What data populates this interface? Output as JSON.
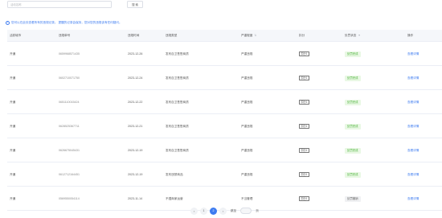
{
  "search": {
    "placeholder": "活动名称",
    "button_label": "搜 索"
  },
  "notice": {
    "icon": "info-circle-icon",
    "text": "您可以在此处查看所有的违规记录。 提醒的记录会保持，您对您的违规该有任何疑问。"
  },
  "table": {
    "headers": {
      "region": "活跃城市",
      "record_no": "违规单号",
      "time": "违规时间",
      "type": "违规类型",
      "level": "严重程度",
      "penalty": "扣分",
      "status": "处罚状态",
      "action": "操作"
    },
    "rows": [
      {
        "region": "开通",
        "record_no": "0659968571435",
        "time": "2023-12-26",
        "type": "发布自卫售售商质",
        "level": "严重违规",
        "penalty": "扣分1",
        "status": "处罚完成",
        "status_type": "ok",
        "action": "查看详情"
      },
      {
        "region": "开通",
        "record_no": "0602710071750",
        "time": "2023-12-24",
        "type": "发布自卫售售商质",
        "level": "严重违规",
        "penalty": "扣分1",
        "status": "处罚完成",
        "status_type": "ok",
        "action": "查看详情"
      },
      {
        "region": "开通",
        "record_no": "0651110015424",
        "time": "2023-12-22",
        "type": "发布自卫售售商质",
        "level": "严重违规",
        "penalty": "扣分1",
        "status": "处罚完成",
        "status_type": "ok",
        "action": "查看详情"
      },
      {
        "region": "开通",
        "record_no": "0628525367711",
        "time": "2023-12-21",
        "type": "发布自卫售售商质",
        "level": "严重违规",
        "penalty": "扣分1",
        "status": "处罚完成",
        "status_type": "ok",
        "action": "查看详情"
      },
      {
        "region": "开通",
        "record_no": "0626675045431",
        "time": "2023-12-19",
        "type": "发布自卫售售商质",
        "level": "严重违规",
        "penalty": "扣分1",
        "status": "处罚完成",
        "status_type": "ok",
        "action": "查看详情"
      },
      {
        "region": "开通",
        "record_no": "0612712164451",
        "time": "2023-12-19",
        "type": "发布违禁商品",
        "level": "严重违规",
        "penalty": "扣分1",
        "status": "处罚完成",
        "status_type": "ok",
        "action": "查看详情"
      },
      {
        "region": "开通",
        "record_no": "0569550054114",
        "time": "2023-11-14",
        "type": "不遵商家运营",
        "level": "不当管理",
        "penalty": "扣分1",
        "status": "处罚撤销",
        "status_type": "done",
        "action": "查看详情"
      }
    ]
  },
  "pagination": {
    "prev_icon": "chevron-left-icon",
    "next_icon": "chevron-right-icon",
    "pages": [
      "1",
      "2"
    ],
    "current": "2",
    "goto_label": "跳至",
    "page_suffix": "页"
  },
  "colors": {
    "accent": "#3d7bf0",
    "success_bg": "#e9f8e4",
    "success_text": "#4db23c"
  }
}
